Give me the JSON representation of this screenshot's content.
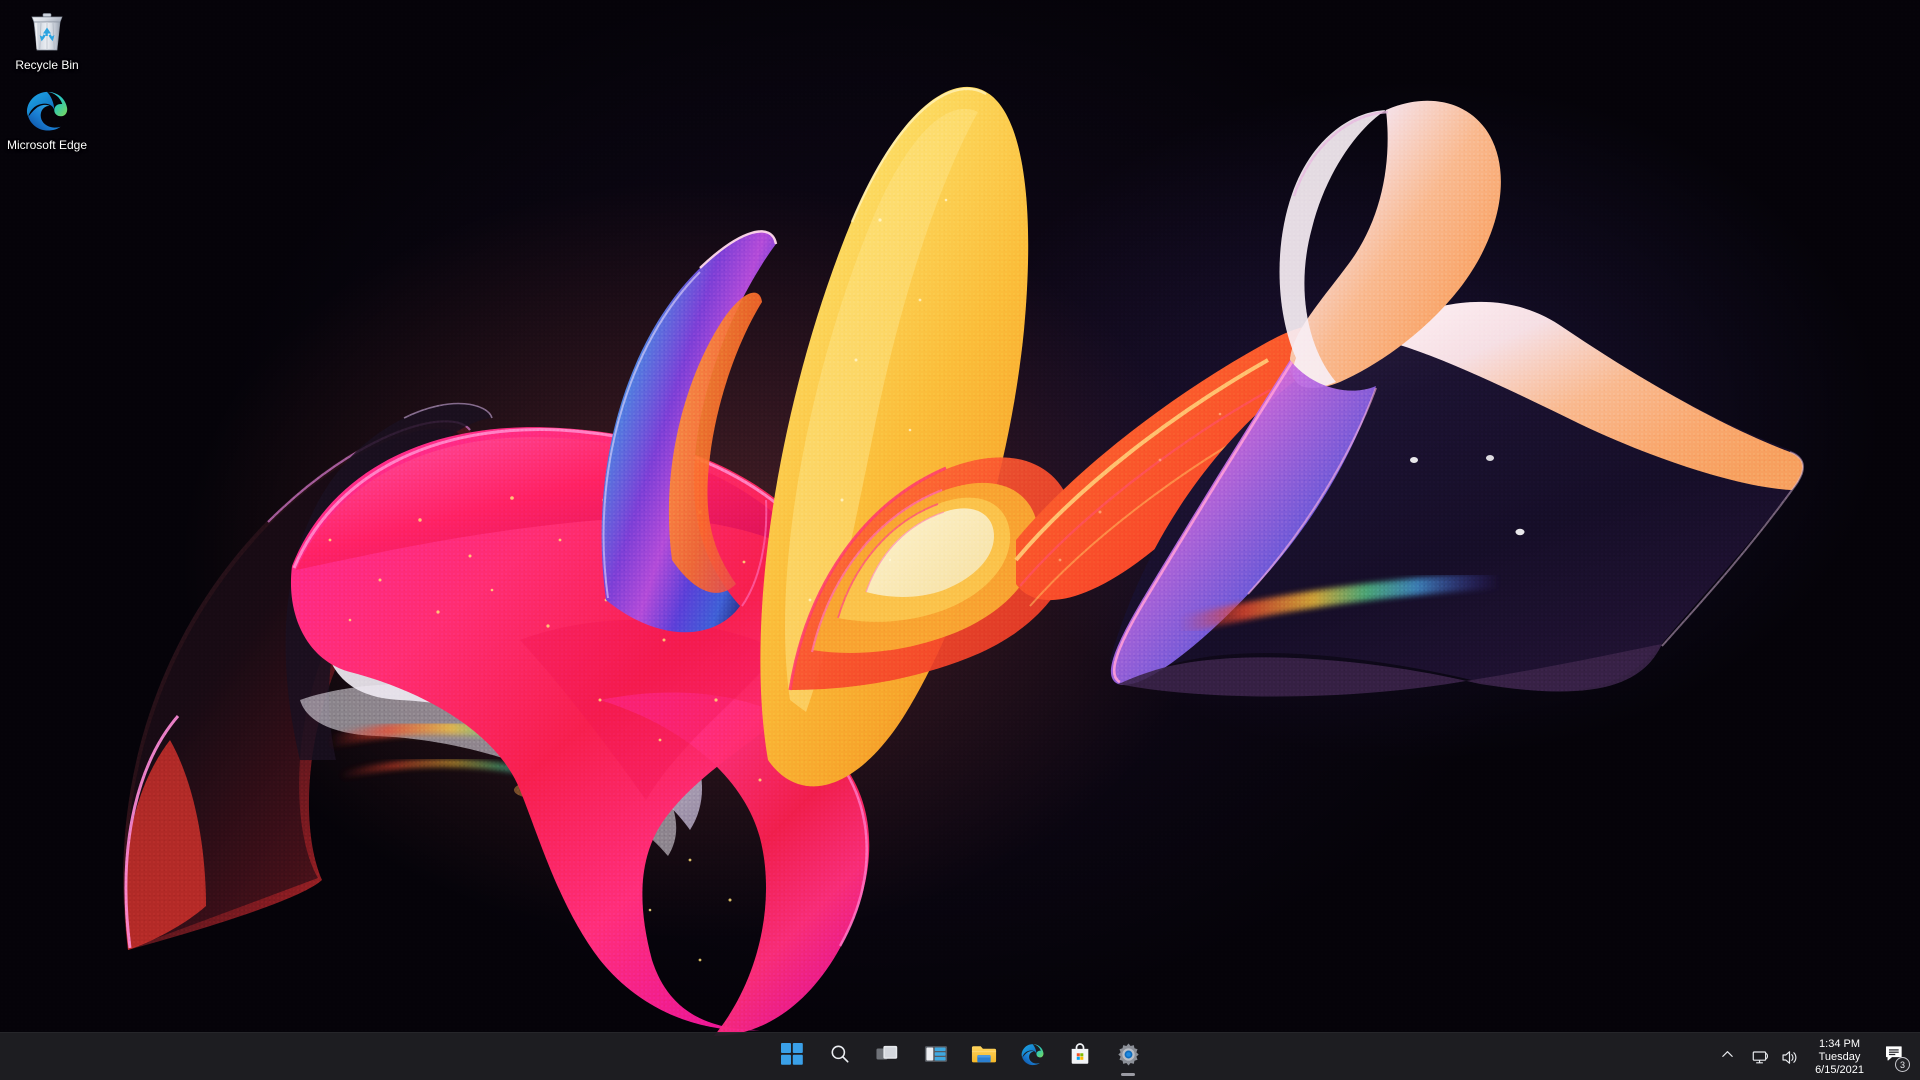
{
  "desktop": {
    "background_color": "#050308",
    "wallpaper_name": "windows-11-bloom-wallpaper",
    "icons": [
      {
        "id": "recycle-bin",
        "label": "Recycle Bin",
        "icon": "recycle-bin-icon",
        "has_shortcut_arrow": false
      },
      {
        "id": "microsoft-edge",
        "label": "Microsoft Edge",
        "icon": "microsoft-edge-icon",
        "has_shortcut_arrow": true
      }
    ]
  },
  "taskbar": {
    "background_color": "#202024",
    "buttons": [
      {
        "id": "start",
        "label": "Start",
        "icon": "windows-logo-icon",
        "active": false
      },
      {
        "id": "search",
        "label": "Search",
        "icon": "search-icon",
        "active": false
      },
      {
        "id": "task-view",
        "label": "Task View",
        "icon": "task-view-icon",
        "active": false
      },
      {
        "id": "widgets",
        "label": "Widgets",
        "icon": "widgets-icon",
        "active": false
      },
      {
        "id": "file-explorer",
        "label": "File Explorer",
        "icon": "folder-icon",
        "active": false
      },
      {
        "id": "edge",
        "label": "Microsoft Edge",
        "icon": "microsoft-edge-icon",
        "active": false
      },
      {
        "id": "store",
        "label": "Microsoft Store",
        "icon": "microsoft-store-icon",
        "active": false
      },
      {
        "id": "settings",
        "label": "Settings",
        "icon": "settings-gear-icon",
        "active": true
      }
    ],
    "tray": {
      "show_hidden_label": "Show hidden icons",
      "show_hidden_icon": "chevron-up-icon",
      "icons": [
        {
          "id": "network",
          "label": "Network",
          "icon": "network-monitor-icon"
        },
        {
          "id": "volume",
          "label": "Volume",
          "icon": "speaker-icon"
        }
      ],
      "clock": {
        "time": "1:34 PM",
        "day": "Tuesday",
        "date": "6/15/2021"
      },
      "notifications": {
        "label": "Chat / Notifications",
        "icon": "notification-chat-icon",
        "count": "3"
      }
    }
  }
}
